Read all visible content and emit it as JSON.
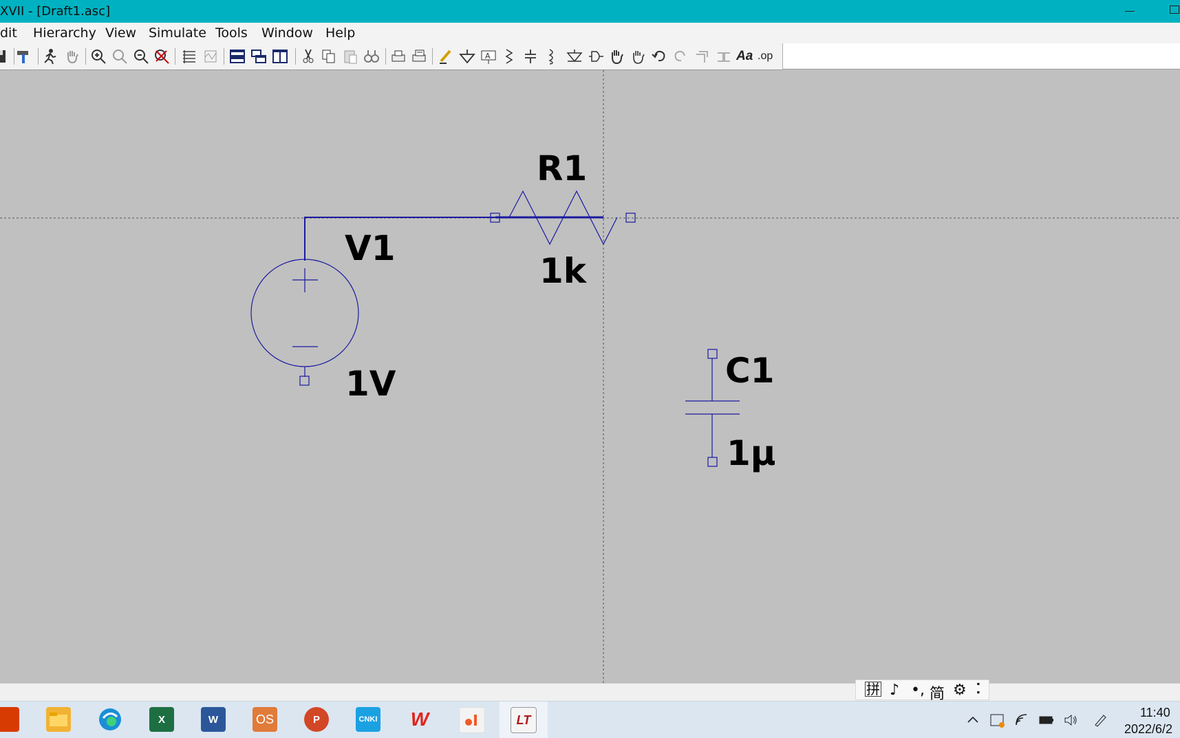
{
  "window": {
    "title": "XVII - [Draft1.asc]"
  },
  "menu": {
    "items": [
      {
        "label": "Edit",
        "shown": "dit"
      },
      {
        "label": "Hierarchy"
      },
      {
        "label": "View"
      },
      {
        "label": "Simulate"
      },
      {
        "label": "Tools"
      },
      {
        "label": "Window"
      },
      {
        "label": "Help"
      }
    ]
  },
  "toolbar": {
    "icons": [
      "save-icon",
      "hammer-icon",
      "run-icon",
      "halt-hand-icon",
      "zoom-in-icon",
      "pan-icon",
      "zoom-out-icon",
      "zoom-fit-icon",
      "autoscale-icon",
      "waveform-icon",
      "tile-horizontal-icon",
      "cascade-icon",
      "tile-vertical-icon",
      "cut-icon",
      "copy-icon",
      "paste-icon",
      "find-icon",
      "print-icon",
      "print-preview-icon",
      "draw-wire-icon",
      "ground-icon",
      "label-net-icon",
      "resistor-icon",
      "capacitor-icon",
      "inductor-icon",
      "diode-icon",
      "component-icon",
      "move-icon",
      "drag-icon",
      "undo-icon",
      "redo-icon",
      "rotate-icon",
      "mirror-icon",
      "text-icon",
      "spice-directive-icon"
    ],
    "text_label": "Aa",
    "directive_label": ".op"
  },
  "schematic": {
    "components": [
      {
        "ref": "V1",
        "value": "1V",
        "type": "voltage-source"
      },
      {
        "ref": "R1",
        "value": "1k",
        "type": "resistor"
      },
      {
        "ref": "C1",
        "value": "1µ",
        "type": "capacitor"
      }
    ],
    "wire_color": "#1a1aa0"
  },
  "ime": {
    "items": [
      "拼",
      "♪",
      "•,",
      "简",
      "⚙",
      "⠅"
    ]
  },
  "taskbar": {
    "apps": [
      {
        "name": "office",
        "label": "",
        "color": "#d83b01"
      },
      {
        "name": "file-explorer",
        "label": "",
        "color": "#f2b233"
      },
      {
        "name": "edge",
        "label": "",
        "color": "#1a8fd6"
      },
      {
        "name": "excel",
        "label": "X",
        "color": "#1d6f42"
      },
      {
        "name": "word",
        "label": "W",
        "color": "#2b579a"
      },
      {
        "name": "os",
        "label": "OS",
        "color": "#e07b39"
      },
      {
        "name": "powerpoint",
        "label": "P",
        "color": "#d24726"
      },
      {
        "name": "cnki",
        "label": "CNKI",
        "color": "#1ba1e2"
      },
      {
        "name": "wps",
        "label": "W",
        "color": "#e2231a"
      },
      {
        "name": "slides-app",
        "label": "",
        "color": "#f05a28"
      },
      {
        "name": "ltspice",
        "label": "LT",
        "color": "#b0181e"
      }
    ],
    "time": "11:40",
    "date": "2022/6/2"
  }
}
